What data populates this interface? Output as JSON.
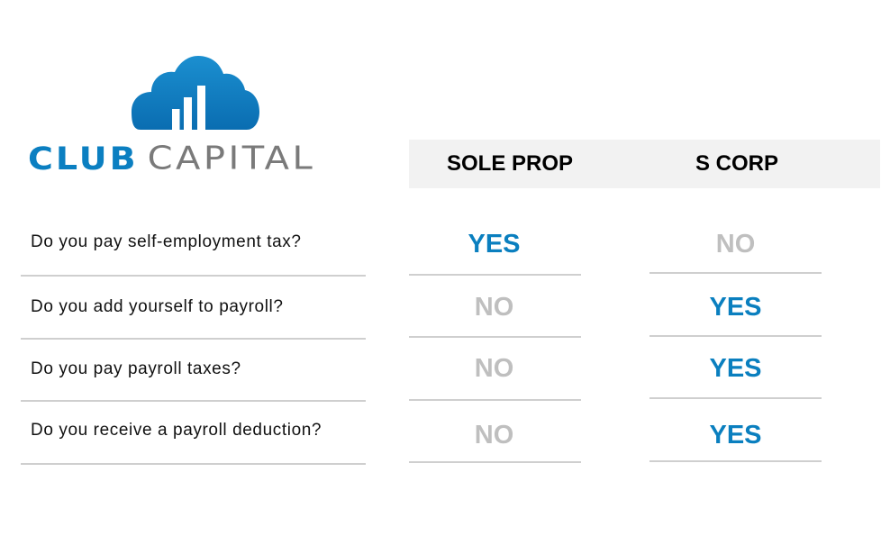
{
  "logo": {
    "icon": "cloud-bar-chart-icon",
    "word_primary": "CLUB",
    "word_secondary": "CAPITAL",
    "primary_color": "#0b7fc1",
    "secondary_color": "#7a7a7a"
  },
  "table": {
    "columns": [
      "SOLE PROP",
      "S CORP"
    ],
    "rows": [
      {
        "question": "Do you pay self-employment tax?",
        "sole_prop": "YES",
        "s_corp": "NO"
      },
      {
        "question": "Do you add yourself to payroll?",
        "sole_prop": "NO",
        "s_corp": "YES"
      },
      {
        "question": "Do you pay payroll taxes?",
        "sole_prop": "NO",
        "s_corp": "YES"
      },
      {
        "question": "Do you receive a payroll deduction?",
        "sole_prop": "NO",
        "s_corp": "YES"
      }
    ]
  },
  "colors": {
    "yes": "#0a7fbf",
    "no": "#bfbfbf",
    "header_bg": "#f2f2f2",
    "divider": "#cfcfcf"
  }
}
